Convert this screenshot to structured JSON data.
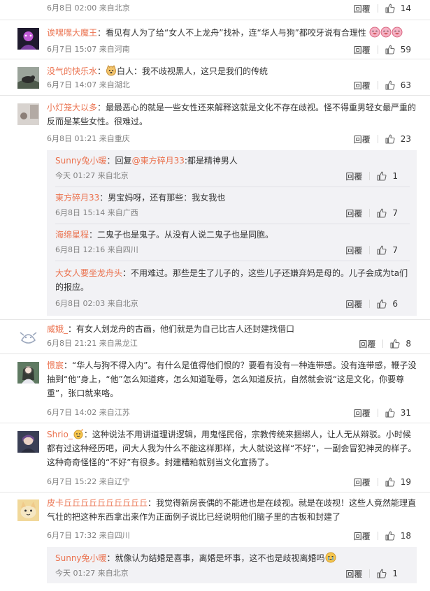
{
  "comments": [
    {
      "id": "c0",
      "meta": "6月8日 02:00 来自北京",
      "likes": "14"
    },
    {
      "id": "c1",
      "user": "诶嘿嘿大魔王",
      "text": "：看见有人为了给“女人不上龙舟”找补，连“华人与狗”都咬牙说有合理性",
      "meta": "6月7日 15:07 来自河南",
      "likes": "59"
    },
    {
      "id": "c2",
      "user": "没气的快乐水",
      "text": "白人：我不歧视黑人，这只是我们的传统",
      "meta": "6月7日 14:07 来自湖北",
      "likes": "63"
    },
    {
      "id": "c3",
      "user": "小灯笼大以多",
      "text": "：最最恶心的就是一些女性还来解释这就是文化不存在歧视。怪不得重男轻女最严重的反而是某些女性。很难过。",
      "meta": "6月8日 01:21 来自重庆",
      "likes": "23"
    },
    {
      "id": "c4",
      "user": "威娥_",
      "text": "：有女人划龙舟的古画，他们就是为自己比古人还封建找借口",
      "meta": "6月8日 21:21 来自黑龙江",
      "likes": "8"
    },
    {
      "id": "c5",
      "user": "憬宸",
      "text": "：“华人与狗不得入内”。有什么是值得他们恨的？要看有没有一种连带感。没有连带感，鞭子没抽到“他”身上，“他”怎么知道疼，怎么知道耻辱，怎么知道反抗，自然就会说“这是文化，你要尊重”，张口就来咯。",
      "meta": "6月7日 14:02 来自江苏",
      "likes": "31"
    },
    {
      "id": "c6",
      "user": "Shrio_",
      "text": "：这种说法不用讲道理讲逻辑，用鬼怪民俗，宗教传统来捆绑人，让人无从辩驳。小时候都有过这种经历吧，问大人我为什么不能这样那样，大人就说这样“不好”，一副会冒犯神灵的样子。这种奇奇怪怪的“不好”有很多。封建糟粕就别当文化宣扬了。",
      "meta": "6月7日 15:22 来自辽宁",
      "likes": "19"
    },
    {
      "id": "c7",
      "user": "皮卡丘丘丘丘丘丘丘丘丘丘",
      "text": "：我觉得新房丧偶的不能进也是在歧视。就是在歧视！这些人竟然能理直气壮的把这种东西拿出来作为正面例子说比已经说明他们脑子里的古板和封建了",
      "meta": "6月7日 17:32 来自四川",
      "likes": "18"
    }
  ],
  "replies": [
    {
      "id": "r1",
      "user": "Sunny兔小暖",
      "pre": "：回复",
      "mention": "@東方碎月33",
      "post": ":都是精神男人",
      "meta": "今天 01:27 来自北京",
      "likes": "1"
    },
    {
      "id": "r2",
      "user": "東方碎月33",
      "text": "：男宝妈呀，还有那些：我女我也",
      "meta": "6月8日 15:14 来自广西",
      "likes": "7"
    },
    {
      "id": "r3",
      "user": "海绵星程",
      "text": "：二鬼子也是鬼子。从没有人说二鬼子也是同胞。",
      "meta": "6月8日 12:16 来自四川",
      "likes": "7"
    },
    {
      "id": "r4",
      "user": "大女人要坐龙舟头",
      "text": "：不用难过。那些是生了儿子的，这些儿子还嫌弃妈是母的。儿子会成为ta们的报应。",
      "meta": "6月8日 02:03 来自北京",
      "likes": "6"
    },
    {
      "id": "r5",
      "user": "Sunny兔小暖",
      "text": "：就像认为结婚是喜事，离婚是坏事，这不也是歧视离婚吗",
      "meta": "今天 01:27 来自北京",
      "likes": "1"
    }
  ],
  "labels": {
    "reply": "回覆"
  },
  "colors": {
    "username": "#eb7350",
    "meta": "#808080",
    "reply_bg": "#f2f2f5"
  }
}
